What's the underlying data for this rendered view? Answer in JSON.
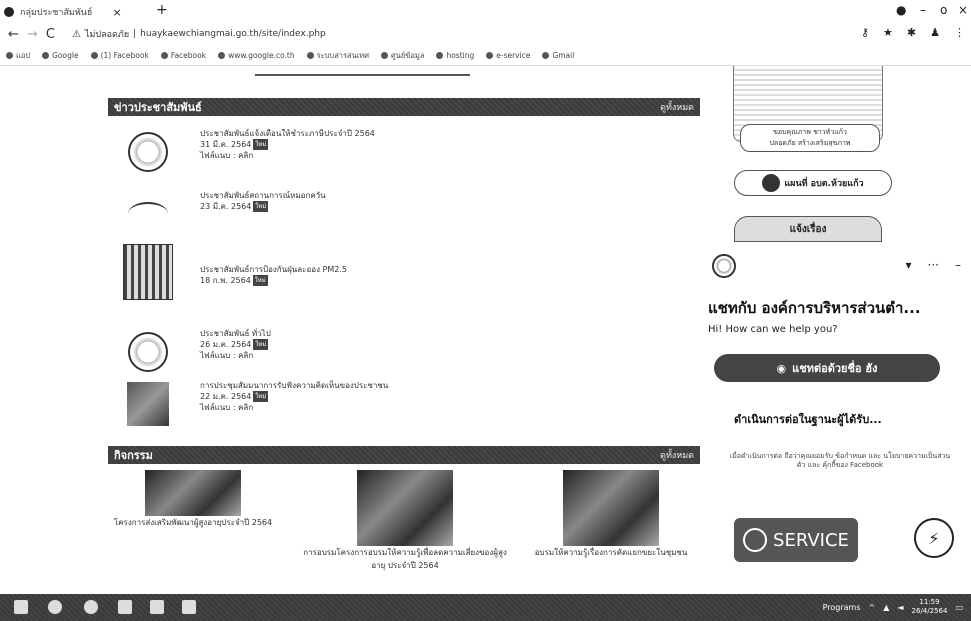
{
  "browser": {
    "tab_title": "กลุ่มประชาสัมพันธ์",
    "tab_close": "×",
    "new_tab": "+",
    "win_min": "–",
    "win_max": "o",
    "win_close": "×",
    "back": "←",
    "forward": "→",
    "reload": "C",
    "security_label": "ไม่ปลอดภัย",
    "url": "huaykaewchiangmai.go.th/site/index.php",
    "bookmarks": [
      "แอป",
      "Google",
      "(1) Facebook",
      "Facebook",
      "www.google.co.th",
      "ระบบสารสนเทศ",
      "ศูนย์ข้อมูล",
      "hosting",
      "e-service",
      "Gmail"
    ]
  },
  "news_section": {
    "title": "ข่าวประชาสัมพันธ์",
    "more": "ดูทั้งหมด",
    "items": [
      {
        "title": "ประชาสัมพันธ์แจ้งเตือนให้ชำระภาษีประจำปี 2564",
        "date": "31 มี.ค. 2564",
        "badge": "ใหม่",
        "views": "ไฟล์แนบ : คลิก"
      },
      {
        "title": "ประชาสัมพันธ์สถานการณ์หมอกควัน",
        "date": "23 มี.ค. 2564",
        "badge": "ใหม่",
        "views": ""
      },
      {
        "title": "ประชาสัมพันธ์การป้องกันฝุ่นละออง PM2.5",
        "date": "18 ก.พ. 2564",
        "badge": "ใหม่",
        "views": ""
      },
      {
        "title": "ประชาสัมพันธ์ ทั่วไป",
        "date": "26 ม.ค. 2564",
        "badge": "ใหม่",
        "views": "ไฟล์แนบ : คลิก"
      },
      {
        "title": "การประชุมสัมมนาการรับฟังความคิดเห็นของประชาชน",
        "date": "22 ม.ค. 2564",
        "badge": "ใหม่",
        "views": "ไฟล์แนบ : คลิก"
      }
    ]
  },
  "activity_section": {
    "title": "กิจกรรม",
    "more": "ดูทั้งหมด",
    "items": [
      {
        "caption": "โครงการส่งเสริมพัฒนาผู้สูงอายุประจำปี 2564"
      },
      {
        "caption": "การอบรมโครงการอบรมให้ความรู้เพื่อลดความเสี่ยงของผู้สูงอายุ ประจำปี 2564"
      },
      {
        "caption": "อบรมให้ความรู้เรื่องการคัดแยกขยะในชุมชน"
      }
    ]
  },
  "sidebar": {
    "caption_1": "ขอบคุณภาพ ชาวหัวแก้ว",
    "caption_2": "ปลอดภัย สร้างเสริมสุขภาพ",
    "map_link": "แผนที่ อบต.ห้วยแก้ว",
    "pill2": "แจ้งเรื่อง"
  },
  "chat": {
    "title": "แชทกับ องค์การบริหารส่วนตำ...",
    "subtitle": "Hi! How can we help you?",
    "button": "แชทต่อด้วยชื่อ ฮัง",
    "status": "ดำเนินการต่อในฐานะผู้ได้รับ...",
    "note": "เมื่อดำเนินการต่อ ถือว่าคุณยอมรับ ข้อกำหนด และ นโยบายความเป็นส่วนตัว และ คุ้กกี้ของ Facebook",
    "eservice": "SERVICE",
    "ctrl_more": "···",
    "ctrl_min": "–",
    "ctrl_menu": "▾"
  },
  "taskbar": {
    "programs": "Programs",
    "time": "11:59",
    "date": "26/4/2564"
  }
}
